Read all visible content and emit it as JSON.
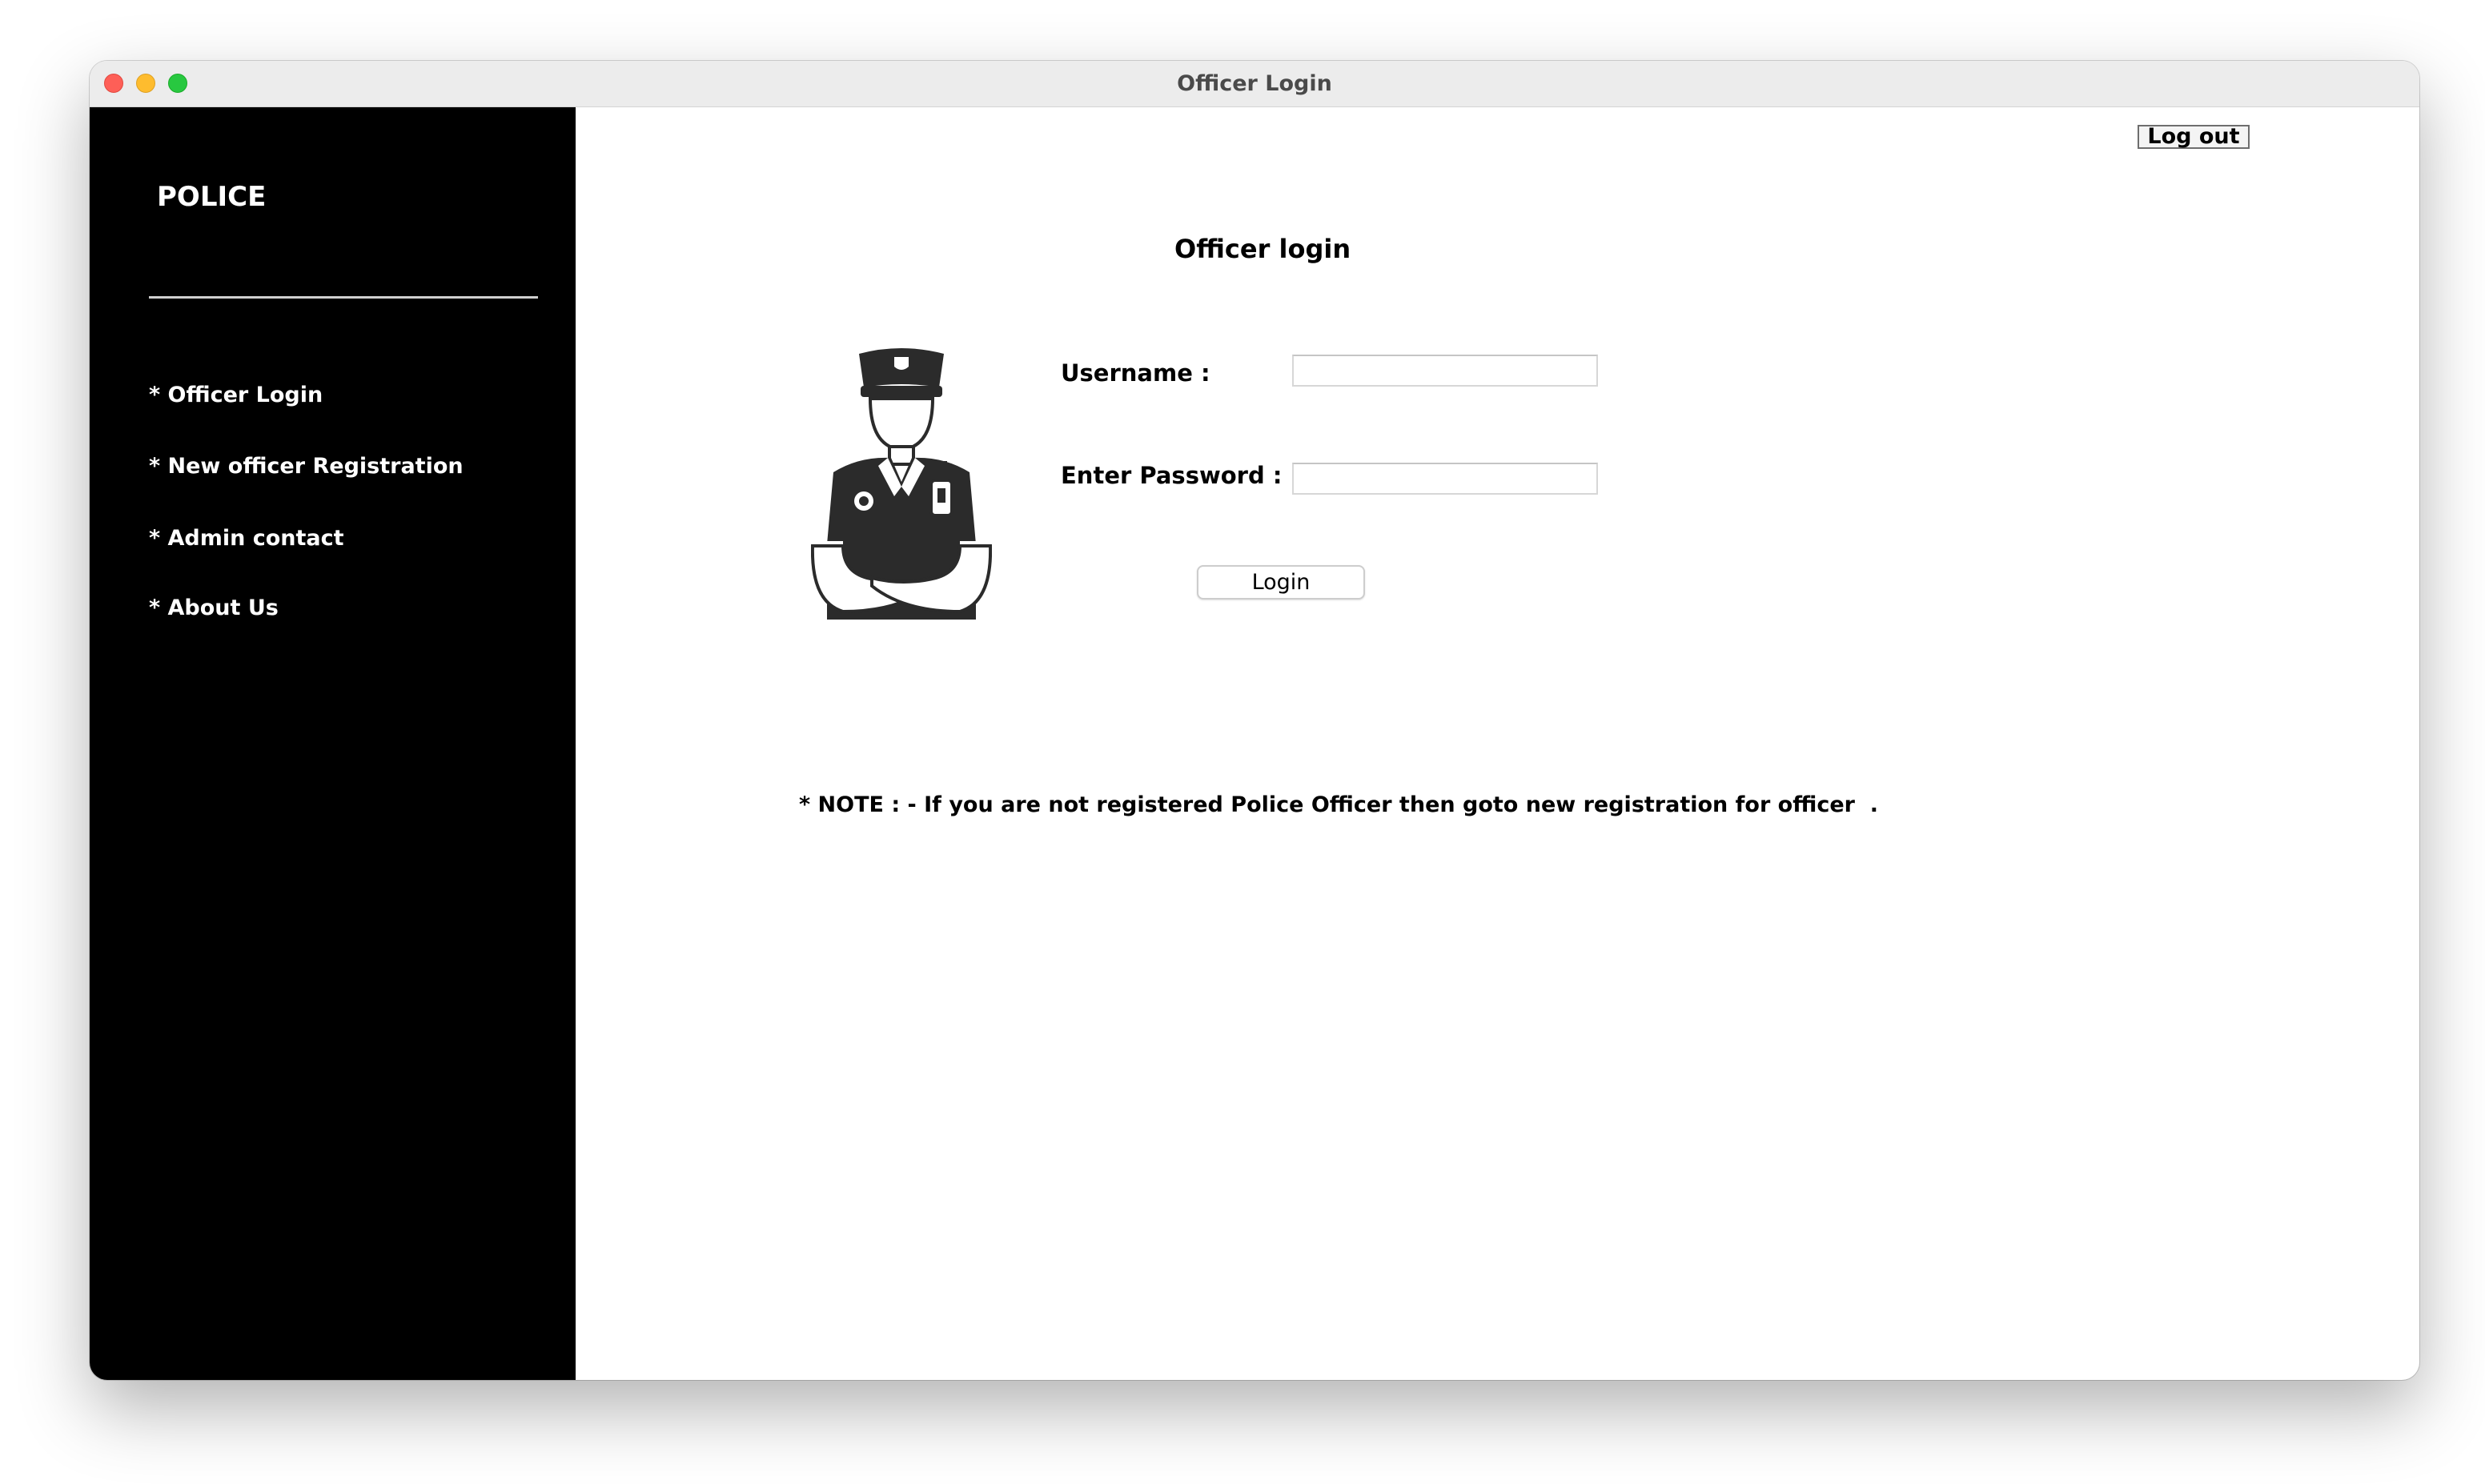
{
  "window": {
    "title": "Officer Login"
  },
  "sidebar": {
    "brand": "POLICE",
    "items": [
      {
        "label": "* Officer Login"
      },
      {
        "label": "* New officer Registration"
      },
      {
        "label": "* Admin contact"
      },
      {
        "label": "* About Us"
      }
    ]
  },
  "header": {
    "logout_label": "Log out"
  },
  "form": {
    "heading": "Officer login",
    "username_label": "Username :",
    "username_value": "",
    "password_label": "Enter Password :",
    "password_value": "",
    "login_label": "Login"
  },
  "note": "* NOTE : - If you are not registered Police Officer then goto new registration for officer  .",
  "icons": {
    "officer": "police-officer-icon"
  },
  "colors": {
    "sidebar_bg": "#000000",
    "sidebar_text": "#ffffff",
    "content_bg": "#ffffff"
  }
}
